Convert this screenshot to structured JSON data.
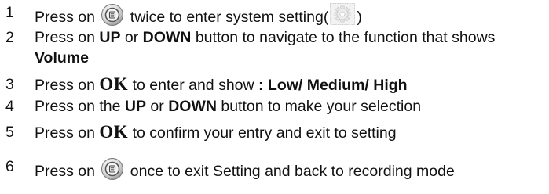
{
  "steps": [
    {
      "number": "1",
      "before": "Press on",
      "after": "twice to enter system setting(",
      "close": ")"
    },
    {
      "number": "2",
      "t1": "Press on ",
      "up": "UP",
      "t2": " or ",
      "down": "DOWN",
      "t3": " button to navigate to the function that shows",
      "line2": "Volume"
    },
    {
      "number": "3",
      "t1": "Press on ",
      "ok": "OK",
      "t2": " to enter and show ",
      "options": ": Low/ Medium/ High"
    },
    {
      "number": "4",
      "t1": "Press on the ",
      "up": "UP",
      "t2": " or ",
      "down": "DOWN",
      "t3": " button to make your selection"
    },
    {
      "number": "5",
      "t1": "Press on ",
      "ok": "OK",
      "t2": " to confirm your entry and exit to setting"
    },
    {
      "number": "6",
      "before": "Press on",
      "after": "once to exit Setting and back to recording mode"
    }
  ]
}
